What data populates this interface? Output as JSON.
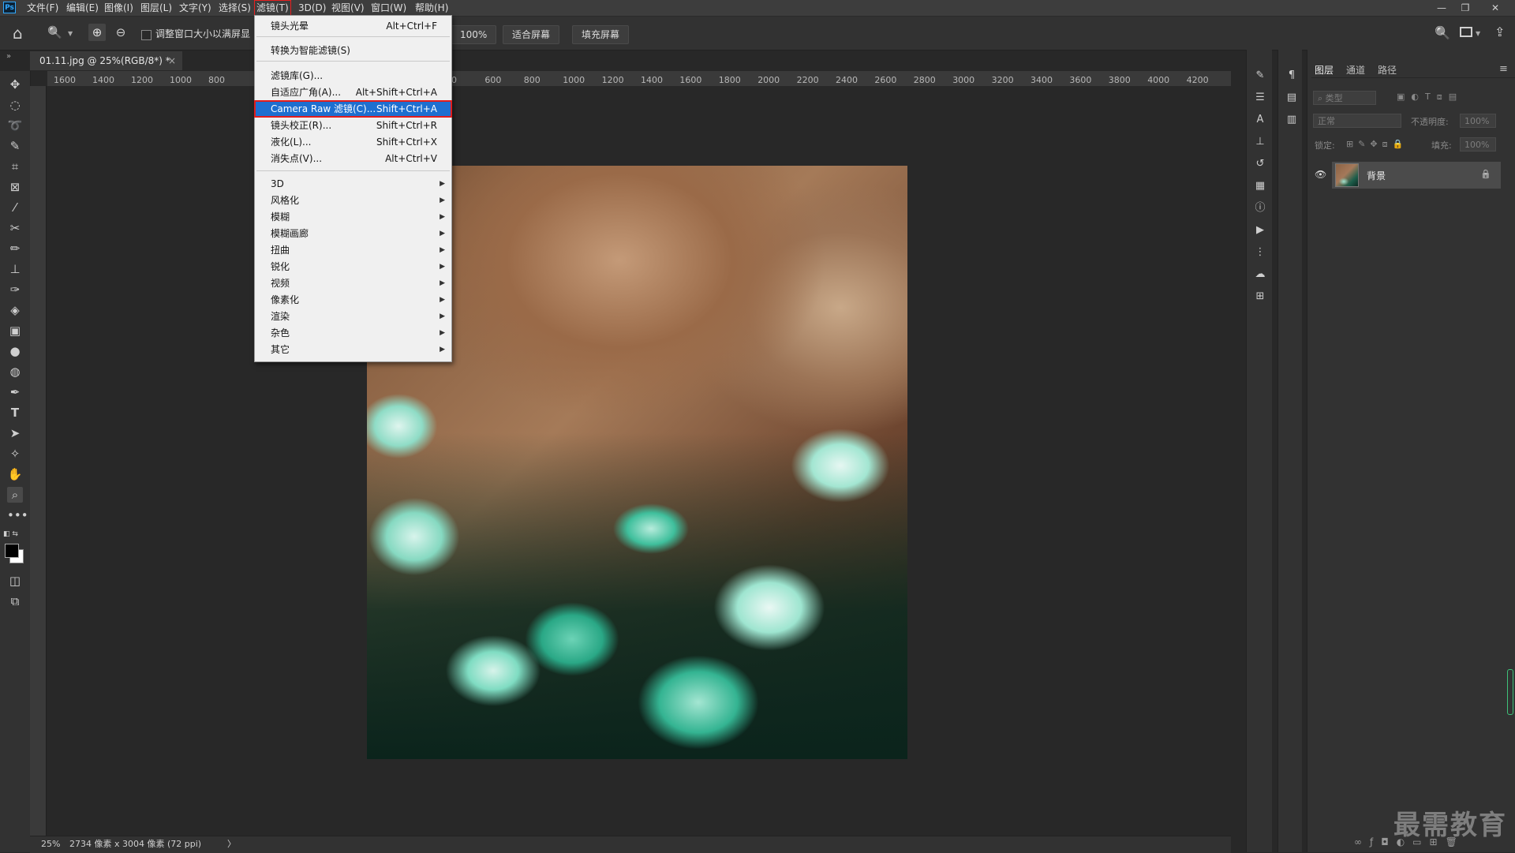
{
  "app": {
    "logo": "Ps"
  },
  "menubar": {
    "items": [
      "文件(F)",
      "编辑(E)",
      "图像(I)",
      "图层(L)",
      "文字(Y)",
      "选择(S)",
      "滤镜(T)",
      "3D(D)",
      "视图(V)",
      "窗口(W)",
      "帮助(H)"
    ],
    "active_index": 6,
    "window_controls": [
      "—",
      "❐",
      "✕"
    ]
  },
  "optionsbar": {
    "home_icon": "⌂",
    "zoom_icon": "🔍",
    "zoom_in_icon": "⊕",
    "zoom_out_icon": "⊖",
    "resize_label": "调整窗口大小以满屏显",
    "btn_100": "100%",
    "btn_fit": "适合屏幕",
    "btn_fill": "填充屏幕"
  },
  "document": {
    "tab_title": "01.11.jpg @ 25%(RGB/8*) *",
    "tab_close": "×"
  },
  "ruler_h": {
    "labels": [
      "1600",
      "1400",
      "1200",
      "1000",
      "800",
      "00",
      "600",
      "800",
      "1000",
      "1200",
      "1400",
      "1600",
      "1800",
      "2000",
      "2200",
      "2400",
      "2600",
      "2800",
      "3000",
      "3200",
      "3400",
      "3600",
      "3800",
      "4000",
      "4200"
    ]
  },
  "filter_menu": {
    "items": [
      {
        "label": "镜头光晕",
        "shortcut": "Alt+Ctrl+F"
      },
      {
        "label": "转换为智能滤镜(S)",
        "shortcut": ""
      },
      {
        "label": "滤镜库(G)...",
        "shortcut": ""
      },
      {
        "label": "自适应广角(A)...",
        "shortcut": "Alt+Shift+Ctrl+A"
      },
      {
        "label": "Camera Raw 滤镜(C)...",
        "shortcut": "Shift+Ctrl+A"
      },
      {
        "label": "镜头校正(R)...",
        "shortcut": "Shift+Ctrl+R"
      },
      {
        "label": "液化(L)...",
        "shortcut": "Shift+Ctrl+X"
      },
      {
        "label": "消失点(V)...",
        "shortcut": "Alt+Ctrl+V"
      }
    ],
    "submenus": [
      "3D",
      "风格化",
      "模糊",
      "模糊画廊",
      "扭曲",
      "锐化",
      "视频",
      "像素化",
      "渲染",
      "杂色",
      "其它"
    ],
    "highlighted": "Camera Raw 滤镜(C)...",
    "submenu_arrow": "▶"
  },
  "layers_panel": {
    "tabs": [
      "图层",
      "通道",
      "路径"
    ],
    "search_placeholder": "类型",
    "blend_mode": "正常",
    "opacity_label": "不透明度:",
    "opacity_value": "100%",
    "lock_label": "锁定:",
    "fill_label": "填充:",
    "fill_value": "100%",
    "layer_name": "背景",
    "menu_icon": "≡",
    "eye_icon": "👁",
    "lock_icon": "🔒"
  },
  "statusbar": {
    "zoom": "25%",
    "info": "2734 像素 x 3004 像素 (72 ppi)",
    "arrow": "〉"
  },
  "watermark": "最需教育",
  "colors": {
    "menu_highlight": "#1e6fd0",
    "annotation_red": "#e11d1d",
    "panel_bg": "#323232",
    "canvas_bg": "#282828"
  }
}
